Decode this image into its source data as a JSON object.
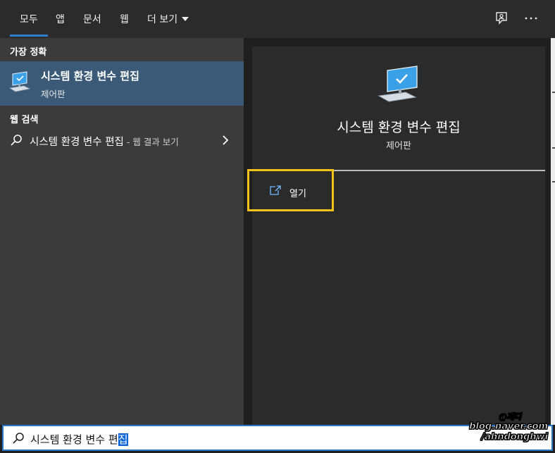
{
  "nav": {
    "tabs": [
      {
        "label": "모두",
        "active": true
      },
      {
        "label": "앱"
      },
      {
        "label": "문서"
      },
      {
        "label": "웹"
      },
      {
        "label": "더 보기"
      }
    ],
    "feedback_icon": "feedback-icon",
    "more_icon": "more-options-icon"
  },
  "results": {
    "best_match_header": "가장 정확",
    "best_match": {
      "title": "시스템 환경 변수 편집",
      "subtitle": "제어판",
      "icon": "control-panel-monitor-icon"
    },
    "web_header": "웹 검색",
    "web_item": {
      "text": "시스템 환경 변수 편집",
      "suffix": " - 웹 결과 보기",
      "icon": "search-icon"
    }
  },
  "detail": {
    "title": "시스템 환경 변수 편집",
    "subtitle": "제어판",
    "open_label": "열기",
    "icon": "control-panel-monitor-icon"
  },
  "search": {
    "query_prefix": "시스템 환경 변수 편",
    "query_selected": "집"
  },
  "watermark": {
    "line1": "@재디",
    "line2": "blog.naver.com",
    "line3": "/ahndonghwi"
  },
  "colors": {
    "accent": "#2f7fd0",
    "highlight_box": "#f4c31a",
    "selected_row": "#3a5a78"
  }
}
